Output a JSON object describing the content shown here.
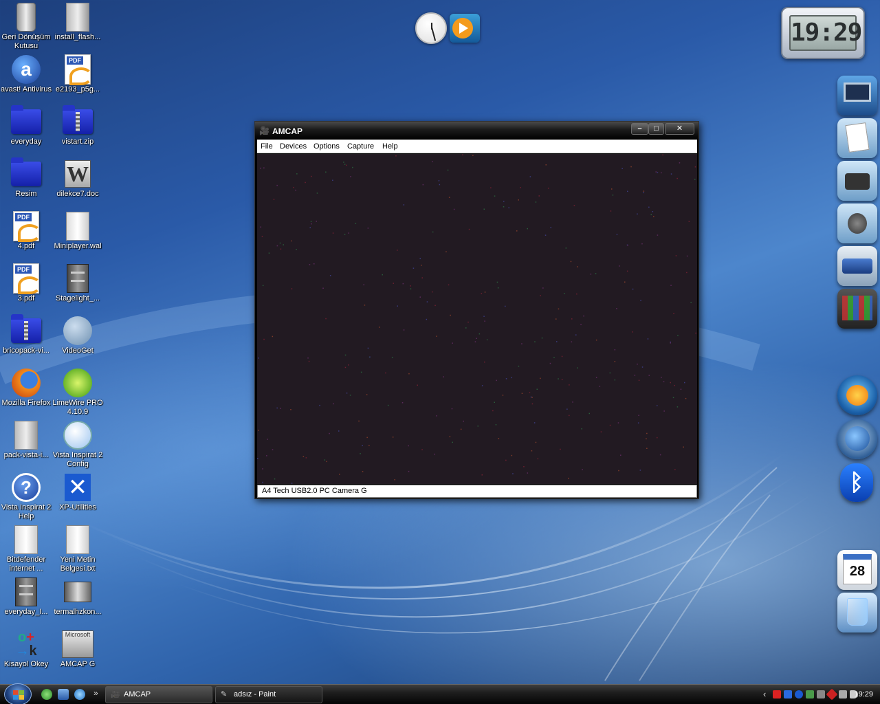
{
  "desktop": {
    "icons": [
      {
        "label": "Geri Dönüşüm Kutusu",
        "icon": "recycle-bin-icon"
      },
      {
        "label": "install_flash...",
        "icon": "installer-icon"
      },
      {
        "label": "avast! Antivirus",
        "icon": "avast-icon"
      },
      {
        "label": "e2193_p5g...",
        "icon": "pdf-icon"
      },
      {
        "label": "everyday",
        "icon": "folder-icon"
      },
      {
        "label": "vistart.zip",
        "icon": "zip-folder-icon"
      },
      {
        "label": "Resim",
        "icon": "folder-icon"
      },
      {
        "label": "dilekce7.doc",
        "icon": "word-doc-icon"
      },
      {
        "label": "4.pdf",
        "icon": "pdf-icon"
      },
      {
        "label": "Miniplayer.wal",
        "icon": "file-icon"
      },
      {
        "label": "3.pdf",
        "icon": "pdf-icon"
      },
      {
        "label": "Stagelight_...",
        "icon": "cabinet-icon"
      },
      {
        "label": "bricopack-vi...",
        "icon": "zip-folder-icon"
      },
      {
        "label": "VideoGet",
        "icon": "videoget-icon"
      },
      {
        "label": "Mozilla Firefox",
        "icon": "firefox-icon"
      },
      {
        "label": "LimeWire PRO 4.10.9",
        "icon": "limewire-icon"
      },
      {
        "label": "pack-vista-i...",
        "icon": "installer-icon"
      },
      {
        "label": "Vista Inspirat 2 Config",
        "icon": "windows-globe-icon"
      },
      {
        "label": "Vista Inspirat 2 Help",
        "icon": "help-icon"
      },
      {
        "label": "XP-Utilities",
        "icon": "xp-utilities-icon"
      },
      {
        "label": "Bitdefender internet ...",
        "icon": "settings-file-icon"
      },
      {
        "label": "Yeni Metin Belgesi.txt",
        "icon": "text-file-icon"
      },
      {
        "label": "everyday_I...",
        "icon": "cabinet-icon"
      },
      {
        "label": "termalhzkon...",
        "icon": "image-file-icon"
      },
      {
        "label": "Kisayol Okey",
        "icon": "ok-shortcut-icon"
      },
      {
        "label": "AMCAP G",
        "icon": "amcap-icon"
      }
    ]
  },
  "clock_widget": {
    "time": "19:29"
  },
  "calendar_dock": {
    "day": "28"
  },
  "window": {
    "title": "AMCAP",
    "buttons": {
      "minimize": "–",
      "maximize": "□",
      "close": "✕"
    },
    "menu": [
      "File",
      "Devices",
      "Options",
      "Capture",
      "Help"
    ],
    "status": "A4 Tech USB2.0 PC Camera G"
  },
  "taskbar": {
    "tasks": [
      {
        "label": "AMCAP",
        "icon": "amcap-icon"
      },
      {
        "label": "adsız - Paint",
        "icon": "paint-icon"
      }
    ],
    "quicklaunch_more": "»",
    "tray_expand": "‹",
    "time": "19:29"
  },
  "colors": {
    "accent": "#2a5aa8",
    "titlebar": "#1b1b1b",
    "video": "#221a22"
  }
}
